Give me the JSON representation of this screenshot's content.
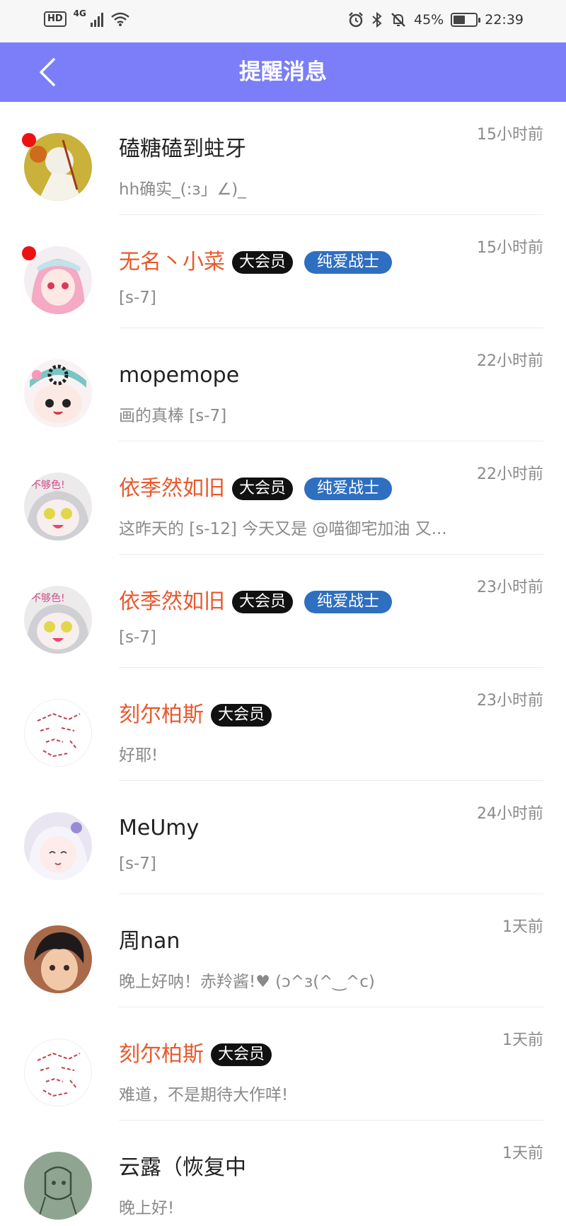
{
  "status_bar": {
    "hd": "HD",
    "network": "4G",
    "battery": "45%",
    "time": "22:39"
  },
  "header": {
    "title": "提醒消息"
  },
  "colors": {
    "nav_bg": "#7b7ef8",
    "vip_name": "#e8592d",
    "tag_bg": "#2f6fc1",
    "unread_dot": "#ee1111"
  },
  "messages": [
    {
      "name": "磕糖磕到蛀牙",
      "vip": false,
      "vip_label": "",
      "tag": "",
      "preview": "hh确实_(:з」∠)_",
      "time": "15小时前",
      "unread": true
    },
    {
      "name": "无名丶小菜",
      "vip": true,
      "vip_label": "大会员",
      "tag": "纯爱战士",
      "preview": "[s-7]",
      "time": "15小时前",
      "unread": true
    },
    {
      "name": "mopemope",
      "vip": false,
      "vip_label": "",
      "tag": "",
      "preview": "画的真棒 [s-7]",
      "time": "22小时前",
      "unread": false
    },
    {
      "name": "依季然如旧",
      "vip": true,
      "vip_label": "大会员",
      "tag": "纯爱战士",
      "preview": "这昨天的 [s-12] 今天又是 @喵御宅加油 又...",
      "time": "22小时前",
      "unread": false
    },
    {
      "name": "依季然如旧",
      "vip": true,
      "vip_label": "大会员",
      "tag": "纯爱战士",
      "preview": "[s-7]",
      "time": "23小时前",
      "unread": false
    },
    {
      "name": "刻尔柏斯",
      "vip": true,
      "vip_label": "大会员",
      "tag": "",
      "preview": "好耶!",
      "time": "23小时前",
      "unread": false
    },
    {
      "name": "MeUmy",
      "vip": false,
      "vip_label": "",
      "tag": "",
      "preview": "[s-7]",
      "time": "24小时前",
      "unread": false
    },
    {
      "name": "周nan",
      "vip": false,
      "vip_label": "",
      "tag": "",
      "preview": "晚上好呐！赤羚酱!♥ (ↄ^з(^‿^c)",
      "time": "1天前",
      "unread": false
    },
    {
      "name": "刻尔柏斯",
      "vip": true,
      "vip_label": "大会员",
      "tag": "",
      "preview": "难道，不是期待大作咩!",
      "time": "1天前",
      "unread": false
    },
    {
      "name": "云露（恢复中",
      "vip": false,
      "vip_label": "",
      "tag": "",
      "preview": "晚上好!",
      "time": "1天前",
      "unread": false
    }
  ]
}
